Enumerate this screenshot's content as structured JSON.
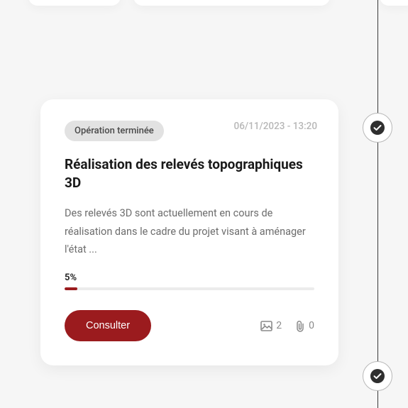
{
  "card": {
    "status": "Opération terminée",
    "timestamp": "06/11/2023 - 13:20",
    "title": "Réalisation des relevés topographiques 3D",
    "description": "Des relevés 3D sont actuellement en cours de réalisation dans le cadre du projet visant à aménager l'état ...",
    "progress_label": "5%",
    "progress_value": 5,
    "action_label": "Consulter",
    "image_count": "2",
    "attachment_count": "0"
  }
}
